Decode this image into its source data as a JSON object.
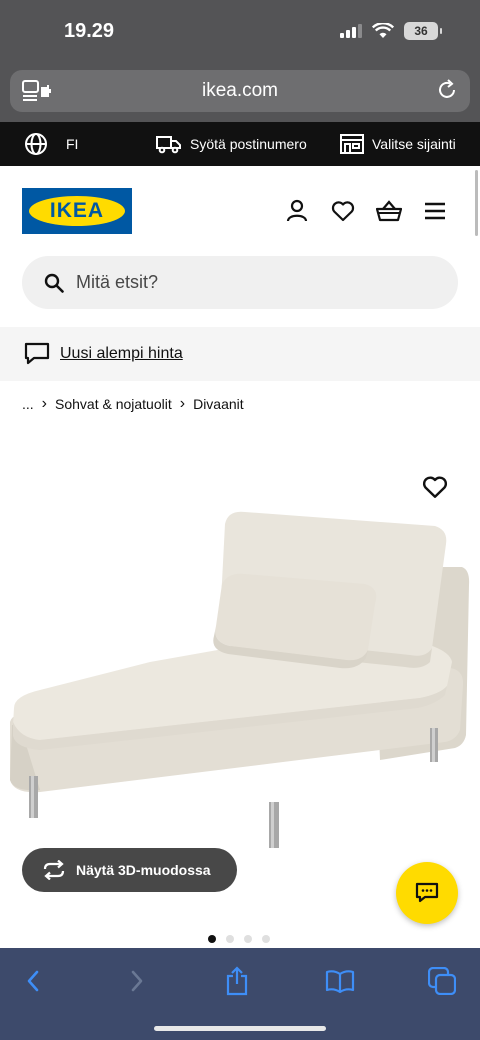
{
  "status": {
    "time": "19.29",
    "battery": "36"
  },
  "browser": {
    "url": "ikea.com"
  },
  "top_strip": {
    "language": "FI",
    "postcode_label": "Syötä postinumero",
    "location_label": "Valitse sijainti"
  },
  "header": {
    "logo_text": "IKEA"
  },
  "search": {
    "placeholder": "Mitä etsit?"
  },
  "promo": {
    "text": "Uusi alempi hinta"
  },
  "breadcrumb": {
    "ellipsis": "...",
    "items": [
      "Sohvat & nojatuolit",
      "Divaanit"
    ]
  },
  "product": {
    "view_3d_label": "Näytä 3D-muodossa",
    "image_count": 4,
    "active_image": 1
  },
  "colors": {
    "ikea_blue": "#0058a3",
    "ikea_yellow": "#ffdb00",
    "safari_bar": "#3d4a6b"
  },
  "icons": [
    "globe-icon",
    "truck-icon",
    "store-icon",
    "user-icon",
    "heart-icon",
    "basket-icon",
    "menu-icon",
    "search-icon",
    "chat-bubble-icon",
    "rotate-3d-icon",
    "back-icon",
    "forward-icon",
    "share-icon",
    "bookmarks-icon",
    "tabs-icon"
  ]
}
